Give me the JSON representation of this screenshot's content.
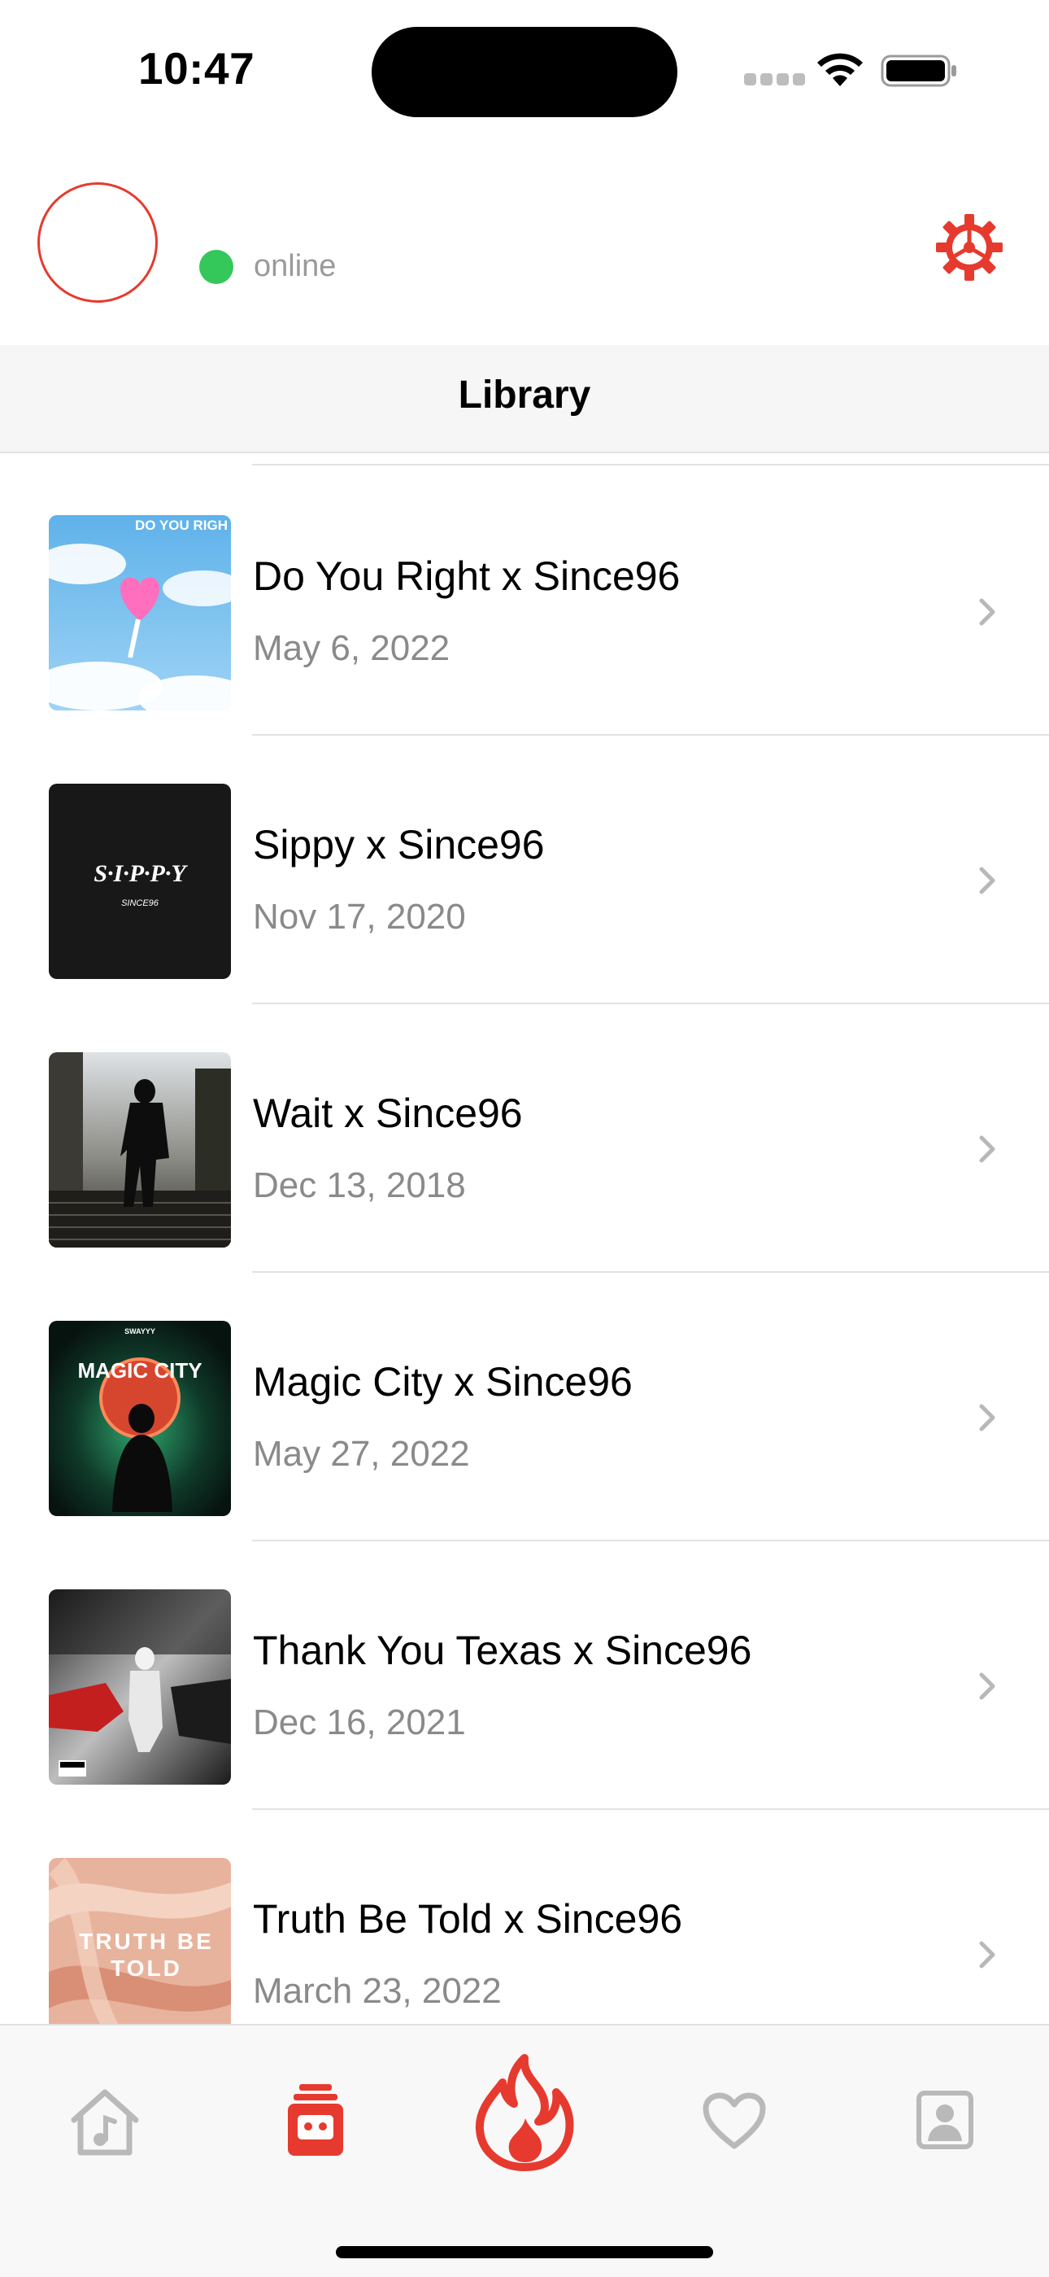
{
  "status_bar": {
    "time": "10:47"
  },
  "header": {
    "presence_label": "online"
  },
  "nav": {
    "title": "Library"
  },
  "colors": {
    "accent": "#e63a2f",
    "online": "#34c759",
    "secondary_text": "#8a8a8a"
  },
  "library": {
    "items": [
      {
        "title": "Do You Right x Since96",
        "date": "May 6, 2022",
        "art_text": "DO YOU RIGH"
      },
      {
        "title": "Sippy x Since96",
        "date": "Nov 17, 2020",
        "art_text": "S·I·P·P·Y",
        "art_subtext": "SINCE96"
      },
      {
        "title": "Wait x Since96",
        "date": "Dec 13, 2018"
      },
      {
        "title": "Magic City x Since96",
        "date": "May 27, 2022",
        "art_text": "MAGIC CITY",
        "art_subtext": "SWAYYY"
      },
      {
        "title": "Thank You Texas x Since96",
        "date": "Dec 16, 2021"
      },
      {
        "title": "Truth Be Told x Since96",
        "date": "March 23, 2022",
        "art_text": "TRUTH BE",
        "art_text_2": "TOLD"
      }
    ]
  },
  "tab_bar": {
    "tabs": [
      {
        "icon": "home-music-icon",
        "active": false
      },
      {
        "icon": "library-icon",
        "active": true
      },
      {
        "icon": "flame-icon",
        "active": true
      },
      {
        "icon": "heart-icon",
        "active": false
      },
      {
        "icon": "profile-icon",
        "active": false
      }
    ]
  }
}
